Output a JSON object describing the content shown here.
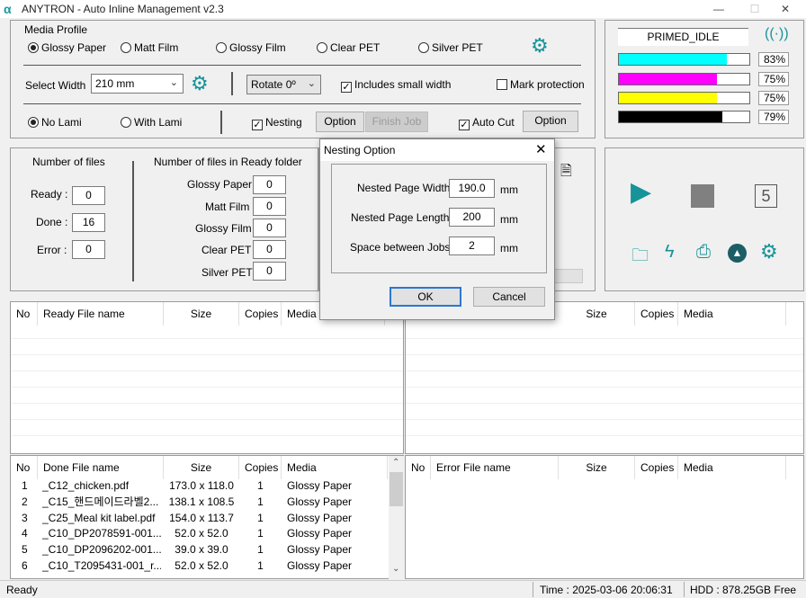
{
  "window": {
    "title": "ANYTRON - Auto Inline Management v2.3",
    "logo": "α",
    "minimize": "—",
    "maximize": "☐",
    "close": "✕"
  },
  "media_profile": {
    "title": "Media Profile",
    "options": [
      "Glossy Paper",
      "Matt Film",
      "Glossy Film",
      "Clear PET",
      "Silver PET"
    ],
    "selected": "Glossy Paper",
    "select_width_label": "Select Width",
    "width_value": "210 mm",
    "rotate_value": "Rotate 0º",
    "includes_small_width": "Includes small width",
    "mark_protection": "Mark protection",
    "no_lami": "No Lami",
    "with_lami": "With Lami",
    "nesting": "Nesting",
    "option_label": "Option",
    "finish_job": "Finish Job",
    "auto_cut": "Auto Cut",
    "option_label_2": "Option"
  },
  "printer_status": {
    "state": "PRIMED_IDLE",
    "inks": [
      {
        "color": "#00ffff",
        "level": 0.83,
        "pct": "83%"
      },
      {
        "color": "#ff00ff",
        "level": 0.75,
        "pct": "75%"
      },
      {
        "color": "#ffff00",
        "level": 0.75,
        "pct": "75%"
      },
      {
        "color": "#000000",
        "level": 0.79,
        "pct": "79%"
      }
    ]
  },
  "counts": {
    "title": "Number of files",
    "ready_label": "Ready :",
    "ready": "0",
    "done_label": "Done :",
    "done": "16",
    "error_label": "Error :",
    "error": "0",
    "folder_title": "Number of files in Ready folder",
    "folder": [
      {
        "label": "Glossy Paper",
        "value": "0"
      },
      {
        "label": "Matt Film",
        "value": "0"
      },
      {
        "label": "Glossy Film",
        "value": "0"
      },
      {
        "label": "Clear PET",
        "value": "0"
      },
      {
        "label": "Silver PET",
        "value": "0"
      }
    ]
  },
  "controls": {
    "counter": "5"
  },
  "ready_table": {
    "headers": [
      "No",
      "Ready File name",
      "Size",
      "Copies",
      "Media"
    ]
  },
  "right_top_table": {
    "headers": [
      "Size",
      "Copies",
      "Media"
    ]
  },
  "done_table": {
    "headers": [
      "No",
      "Done File name",
      "Size",
      "Copies",
      "Media"
    ],
    "rows": [
      [
        "1",
        "_C12_chicken.pdf",
        "173.0 x 118.0",
        "1",
        "Glossy Paper"
      ],
      [
        "2",
        "_C15_핸드메이드라벨2...",
        "138.1 x 108.5",
        "1",
        "Glossy Paper"
      ],
      [
        "3",
        "_C25_Meal kit label.pdf",
        "154.0 x 113.7",
        "1",
        "Glossy Paper"
      ],
      [
        "4",
        "_C10_DP2078591-001...",
        "52.0 x 52.0",
        "1",
        "Glossy Paper"
      ],
      [
        "5",
        "_C10_DP2096202-001...",
        "39.0 x 39.0",
        "1",
        "Glossy Paper"
      ],
      [
        "6",
        "_C10_T2095431-001_r...",
        "52.0 x 52.0",
        "1",
        "Glossy Paper"
      ]
    ]
  },
  "error_table": {
    "headers": [
      "No",
      "Error File name",
      "Size",
      "Copies",
      "Media"
    ]
  },
  "status": {
    "left": "Ready",
    "time": "Time : 2025-03-06 20:06:31",
    "hdd": "HDD : 878.25GB Free"
  },
  "dialog": {
    "title": "Nesting Option",
    "width_label": "Nested Page Width",
    "width_value": "190.0",
    "length_label": "Nested Page Length",
    "length_value": "200",
    "space_label": "Space between Jobs",
    "space_value": "2",
    "unit": "mm",
    "ok": "OK",
    "cancel": "Cancel"
  }
}
